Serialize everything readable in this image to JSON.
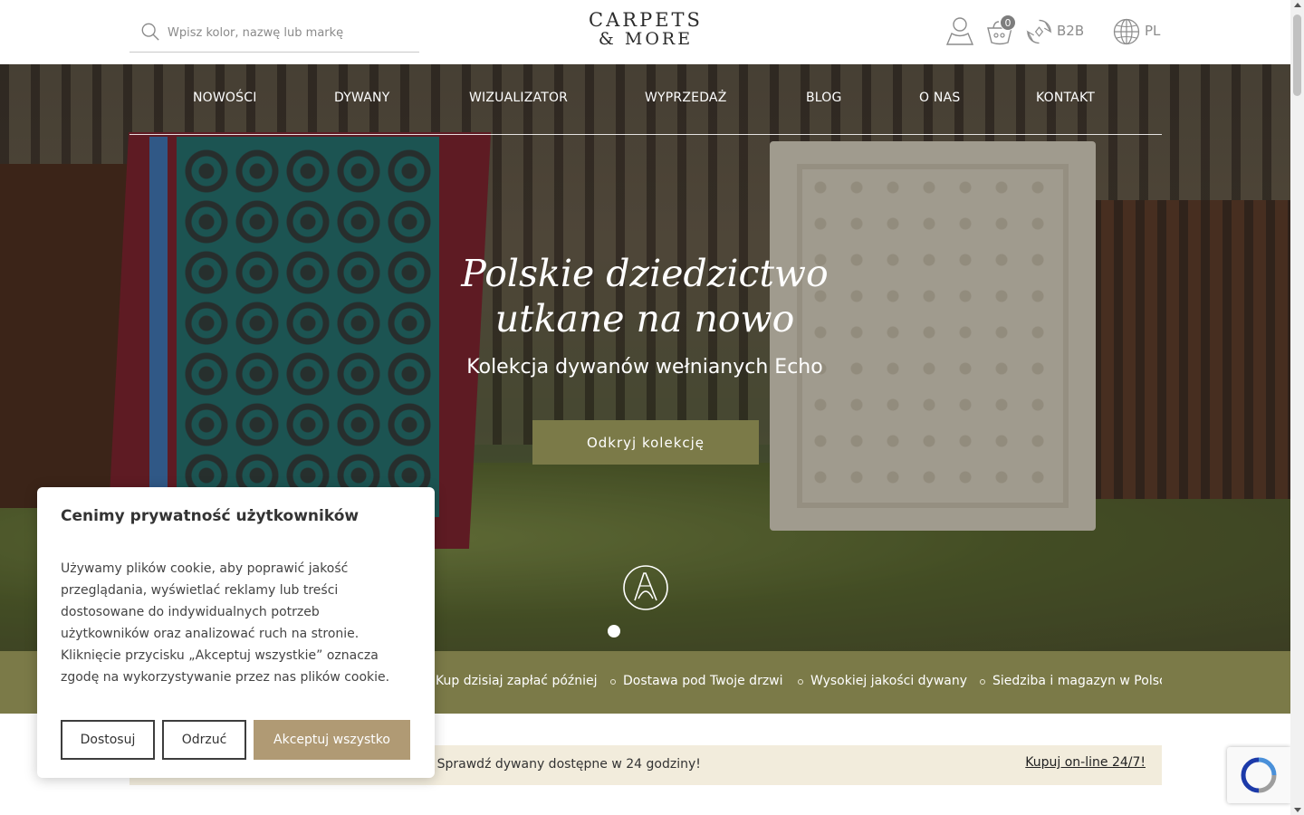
{
  "header": {
    "search": {
      "placeholder": "Wpisz kolor, nazwę lub markę"
    },
    "logo": {
      "line1": "CARPETS",
      "line2": "& MORE"
    },
    "cart_count": "0",
    "b2b_label": "B2B",
    "language": "PL",
    "icons": [
      "search-icon",
      "user-icon",
      "cart-icon",
      "b2b-icon",
      "globe-icon"
    ]
  },
  "nav": {
    "items": [
      {
        "label": "NOWOŚCI"
      },
      {
        "label": "DYWANY"
      },
      {
        "label": "WIZUALIZATOR"
      },
      {
        "label": "WYPRZEDAŻ"
      },
      {
        "label": "BLOG"
      },
      {
        "label": "O NAS"
      },
      {
        "label": "KONTAKT"
      }
    ]
  },
  "hero": {
    "title_line1": "Polskie dziedzictwo",
    "title_line2": "utkane na nowo",
    "subtitle": "Kolekcja dywanów wełnianych Echo",
    "cta": "Odkryj kolekcję",
    "slides_total": 1,
    "slide_active": 1
  },
  "benefits": {
    "items": [
      {
        "label": "Kup dzisiaj zapłać później"
      },
      {
        "label": "Dostawa pod Twoje drzwi"
      },
      {
        "label": "Wysokiej jakości dywany"
      },
      {
        "label": "Siedziba i magazyn w Polsce"
      }
    ]
  },
  "info_strip": {
    "text": "o! Sprawdź dywany dostępne w 24 godziny!",
    "link": "Kupuj on-line 24/7!"
  },
  "cookie": {
    "title": "Cenimy prywatność użytkowników",
    "body": "Używamy plików cookie, aby poprawić jakość przeglądania, wyświetlać reklamy lub treści dostosowane do indywidualnych potrzeb użytkowników oraz analizować ruch na stronie. Kliknięcie przycisku „Akceptuj wszystkie” oznacza zgodę na wykorzystywanie przez nas plików cookie.",
    "btn_customize": "Dostosuj",
    "btn_reject": "Odrzuć",
    "btn_accept": "Akceptuj wszystko"
  },
  "colors": {
    "olive": "#7b7a48",
    "accept_tan": "#b09a74",
    "info_bg": "#f2ecdc"
  }
}
